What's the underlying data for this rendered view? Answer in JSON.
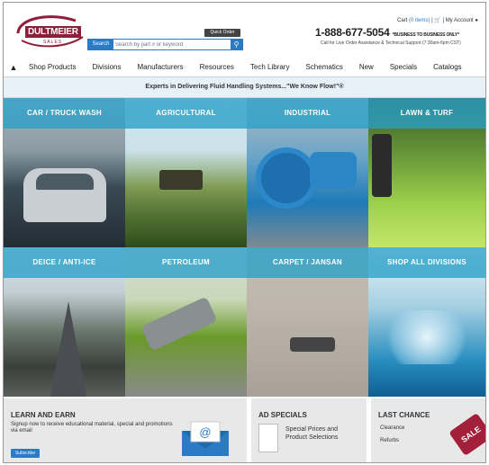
{
  "header": {
    "logo_text": "DULTMEIER",
    "logo_sub": "SALES",
    "quick_order": "Quick Order",
    "search_label": "Search",
    "search_placeholder": "Search by part # or keyword",
    "cart_label": "Cart",
    "cart_items": "(0 items)",
    "account_label": "My Account",
    "phone": "1-888-677-5054",
    "phone_note": "*BUSINESS TO BUSINESS ONLY*",
    "support_text": "Call for Live Order Assistance & Technical Support (7:30am-6pm CST)"
  },
  "nav": {
    "items": [
      "Shop Products",
      "Divisions",
      "Manufacturers",
      "Resources",
      "Tech Library",
      "Schematics",
      "New",
      "Specials",
      "Catalogs"
    ]
  },
  "tagline": "Experts in Delivering Fluid Handling Systems...\"We Know Flow!\"®",
  "tiles": [
    {
      "label": "CAR / TRUCK WASH"
    },
    {
      "label": "AGRICULTURAL"
    },
    {
      "label": "INDUSTRIAL"
    },
    {
      "label": "LAWN & TURF"
    },
    {
      "label": "DEICE / ANTI-ICE"
    },
    {
      "label": "PETROLEUM"
    },
    {
      "label": "CARPET / JANSAN"
    },
    {
      "label": "SHOP ALL DIVISIONS"
    }
  ],
  "promos": {
    "learn": {
      "title": "LEARN AND EARN",
      "text": "Signup now to receive educational material, special and promotions via email",
      "button": "Subscribe"
    },
    "ad": {
      "title": "AD SPECIALS",
      "text": "Special Prices and Product Selections"
    },
    "last": {
      "title": "LAST CHANCE",
      "line1": "Clearance",
      "line2": "Refurbs",
      "tag": "SALE"
    }
  },
  "colors": {
    "brand": "#8e1e3a",
    "accent": "#2b7ac4",
    "tile_bar": "#28a0c8"
  }
}
